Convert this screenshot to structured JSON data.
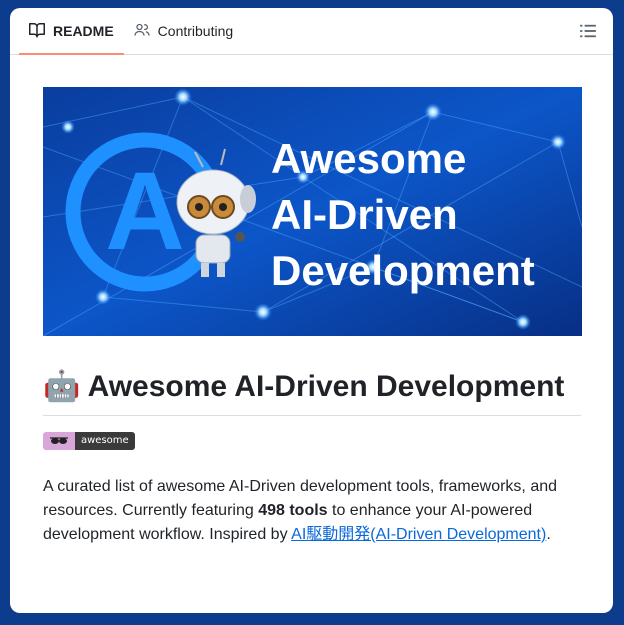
{
  "tabs": [
    {
      "label": "README",
      "icon": "book-icon",
      "active": true
    },
    {
      "label": "Contributing",
      "icon": "people-icon",
      "active": false
    }
  ],
  "toolbar": {
    "outline_icon": "list-icon"
  },
  "banner": {
    "lines": [
      "Awesome",
      "AI-Driven",
      "Development"
    ],
    "logo_letter": "A"
  },
  "readme": {
    "title": "🤖 Awesome AI-Driven Development",
    "badge_text": "awesome",
    "desc_prefix": "A curated list of awesome AI-Driven development tools, frameworks, and resources. Currently featuring ",
    "desc_bold": "498 tools",
    "desc_middle": " to enhance your AI-powered development workflow. Inspired by ",
    "desc_link": "AI駆動開発(AI-Driven Development)",
    "desc_suffix": "."
  },
  "colors": {
    "accent_underline": "#fd8c73",
    "link": "#0969da",
    "frame_background": "#0d3c8c"
  }
}
